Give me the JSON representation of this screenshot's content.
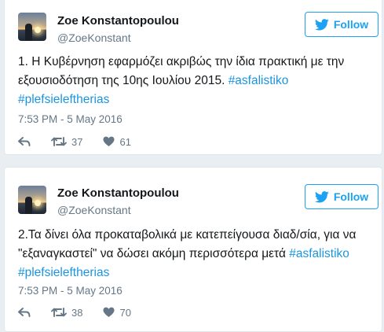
{
  "colors": {
    "link": "#1b95e0",
    "accent": "#1da1f2",
    "muted": "#657786"
  },
  "tweets": [
    {
      "author": {
        "name": "Zoe Konstantopoulou",
        "handle": "@ZoeKonstant"
      },
      "follow_label": "Follow",
      "text": "1. Η Κυβέρνηση εφαρμόζει ακριβώς την ίδια πρακτική με την εξουσιοδότηση της 10ης Ιουλίου 2015. ",
      "hashtags": [
        "#asfalistiko",
        "#plefsieleftherias"
      ],
      "timestamp": "7:53 PM - 5 May 2016",
      "retweets": "37",
      "likes": "61"
    },
    {
      "author": {
        "name": "Zoe Konstantopoulou",
        "handle": "@ZoeKonstant"
      },
      "follow_label": "Follow",
      "text": "2.Τα δίνει όλα προκαταβολικά με κατεπείγουσα διαδ/σία, για να \"εξαναγκαστεί\" να δώσει ακόμη περισσότερα μετά ",
      "hashtags": [
        "#asfalistiko",
        "#plefsieleftherias"
      ],
      "timestamp": "7:53 PM - 5 May 2016",
      "retweets": "38",
      "likes": "70"
    }
  ]
}
